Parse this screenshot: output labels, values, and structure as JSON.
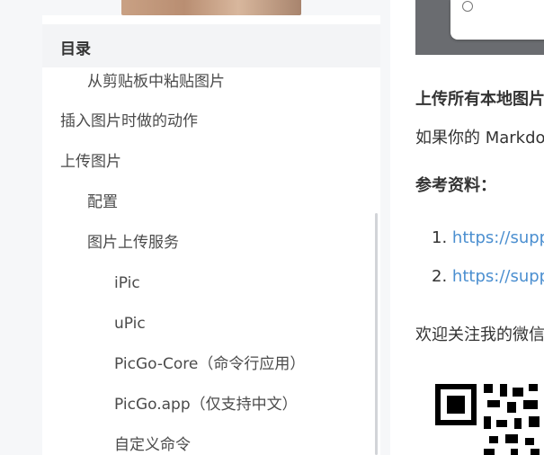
{
  "sidebar": {
    "toc_title": "目录",
    "items": [
      {
        "label": "从剪贴板中粘贴图片",
        "level": 3
      },
      {
        "label": "插入图片时做的动作",
        "level": 2
      },
      {
        "label": "上传图片",
        "level": 2
      },
      {
        "label": "配置",
        "level": 3
      },
      {
        "label": "图片上传服务",
        "level": 3
      },
      {
        "label": "iPic",
        "level": 4
      },
      {
        "label": "uPic",
        "level": 4
      },
      {
        "label": "PicGo-Core（命令行应用）",
        "level": 4
      },
      {
        "label": "PicGo.app（仅支持中文）",
        "level": 4
      },
      {
        "label": "自定义命令",
        "level": 4
      }
    ]
  },
  "article": {
    "upload_heading": "上传所有本地图片",
    "markdown_line": "如果你的 Markdown",
    "references_heading": "参考资料：",
    "references": [
      {
        "num": "1.",
        "url": "https://support.typora.io/"
      },
      {
        "num": "2.",
        "url": "https://support.typora.io/"
      }
    ],
    "follow_line": "欢迎关注我的微信公众号"
  },
  "colors": {
    "link": "#4b8fd0",
    "toc_header_bg": "#f3f4f6",
    "page_bg": "#f6f7f9"
  }
}
